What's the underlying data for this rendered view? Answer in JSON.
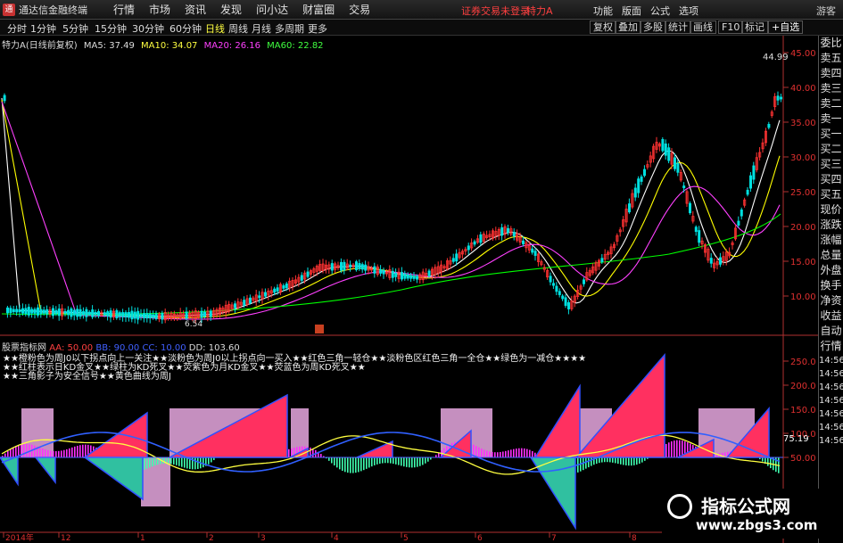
{
  "titlebar": {
    "app_title": "通达信金融终端",
    "menus": [
      "行情",
      "市场",
      "资讯",
      "发现",
      "问小达",
      "财富圈",
      "交易"
    ],
    "login_status": "证券交易未登录",
    "stock_name": "特力A",
    "right_menus": [
      "功能",
      "版面",
      "公式",
      "选项"
    ],
    "guest": "游客"
  },
  "toolbar": {
    "periods": [
      "分时",
      "1分钟",
      "5分钟",
      "15分钟",
      "30分钟",
      "60分钟",
      "日线",
      "周线",
      "月线",
      "多周期",
      "更多"
    ],
    "active_period": "日线",
    "buttons": [
      "复权",
      "叠加",
      "多股",
      "统计",
      "画线",
      "F10",
      "标记",
      "+自选"
    ]
  },
  "chart_header": {
    "name": "特力A(日线前复权)",
    "ma5": "MA5: 37.49",
    "ma10": "MA10: 34.07",
    "ma20": "MA20: 26.16",
    "ma60": "MA60: 22.82"
  },
  "price_axis": {
    "labels": [
      "45.00",
      "40.00",
      "35.00",
      "30.00",
      "25.00",
      "20.00",
      "15.00",
      "10.00"
    ],
    "high_marker": "44.99",
    "low_marker": "6.54"
  },
  "indicator": {
    "name": "股票指标网",
    "aa": "AA: 50.00",
    "bb": "BB: 90.00",
    "cc": "CC: 10.00",
    "dd": "DD: 103.60",
    "axis_labels": [
      "250.0",
      "200.0",
      "150.0",
      "100.0",
      "50.00"
    ],
    "value_marker": "75.19",
    "notes": [
      "★★橙粉色为周J0以下拐点向上一关注★★淡粉色为周J0以上拐点向一买入★★红色三角一轻仓★★淡粉色区红色三角一全仓★★绿色为一减仓★★★★",
      "★★红柱表示日KD金叉★★绿柱为KD死叉★★荧紫色为月KD金叉★★荧蓝色为周KD死叉★★",
      "★★三角影子为安全信号★★黄色曲线为周J"
    ]
  },
  "time_axis": [
    "2014年",
    "12",
    "1",
    "2",
    "3",
    "4",
    "5",
    "6",
    "7",
    "8"
  ],
  "right_sidebar": [
    "委比",
    "卖五",
    "卖四",
    "卖三",
    "卖二",
    "卖一",
    "买一",
    "买二",
    "买三",
    "买四",
    "买五",
    "现价",
    "涨跌",
    "涨幅",
    "总量",
    "外盘",
    "换手",
    "净资",
    "收益",
    "自动",
    "行情",
    "14:56",
    "14:56",
    "14:56",
    "14:56",
    "14:56",
    "14:56",
    "14:56"
  ],
  "watermark": {
    "title": "指标公式网",
    "url": "www.zbgs3.com"
  },
  "colors": {
    "up": "#ff3232",
    "down": "#00e0e0",
    "ma5": "#ffffff",
    "ma10": "#ffff00",
    "ma20": "#ff40ff",
    "ma60": "#00ff00"
  }
}
